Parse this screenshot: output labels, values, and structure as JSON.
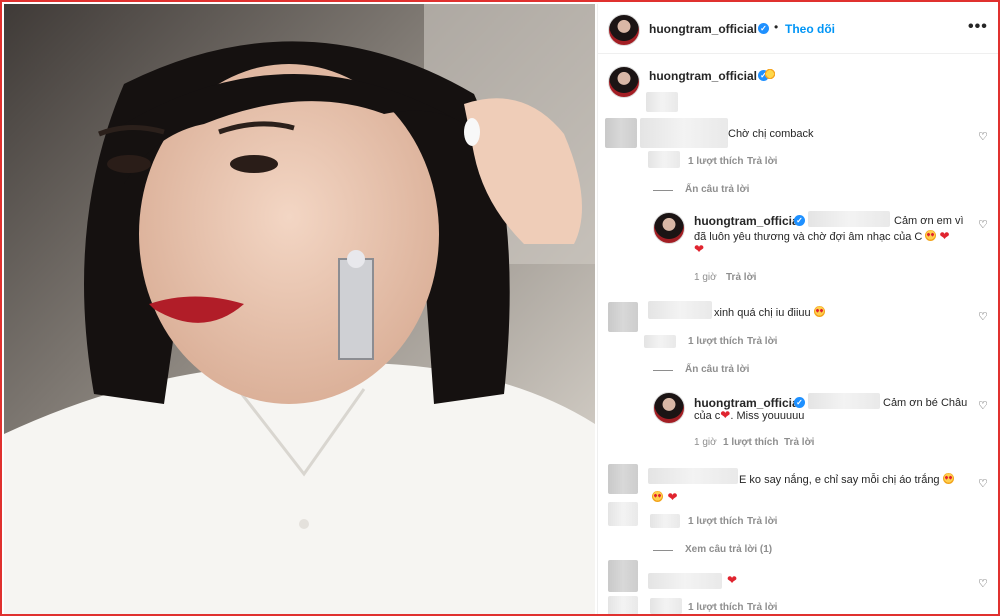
{
  "post": {
    "username": "huongtram_official",
    "follow_label": "Theo dõi",
    "more_icon": "•••",
    "caption_emoji": "sun"
  },
  "comments": [
    {
      "text": "Chờ chị comback",
      "likes": "1 lượt thích",
      "reply": "Trả lời",
      "toggle": "Ẩn câu trả lời"
    },
    {
      "username": "huongtram_official",
      "text_line1": "Cảm ơn em vì",
      "text_line2": "đã luôn yêu thương và chờ đợi âm nhạc của C",
      "time": "1 giờ",
      "reply": "Trả lời"
    },
    {
      "text": "xinh quá chị iu điiuu",
      "likes": "1 lượt thích",
      "reply": "Trả lời",
      "toggle": "Ẩn câu trả lời"
    },
    {
      "username": "huongtram_official",
      "text_line1": "Cảm ơn bé Châu",
      "text_line2_a": "của c",
      "text_line2_b": ". Miss youuuuu",
      "time": "1 giờ",
      "likes": "1 lượt thích",
      "reply": "Trả lời"
    },
    {
      "text": "E ko say nắng, e chỉ say mỗi chị áo trắng",
      "likes": "1 lượt thích",
      "reply": "Trả lời",
      "toggle": "Xem câu trả lời (1)"
    },
    {
      "likes": "1 lượt thích",
      "reply": "Trả lời"
    }
  ],
  "colors": {
    "follow": "#0095f6",
    "verified": "#1e90ff",
    "frame": "#e0312f",
    "heart": "#e0242f"
  }
}
